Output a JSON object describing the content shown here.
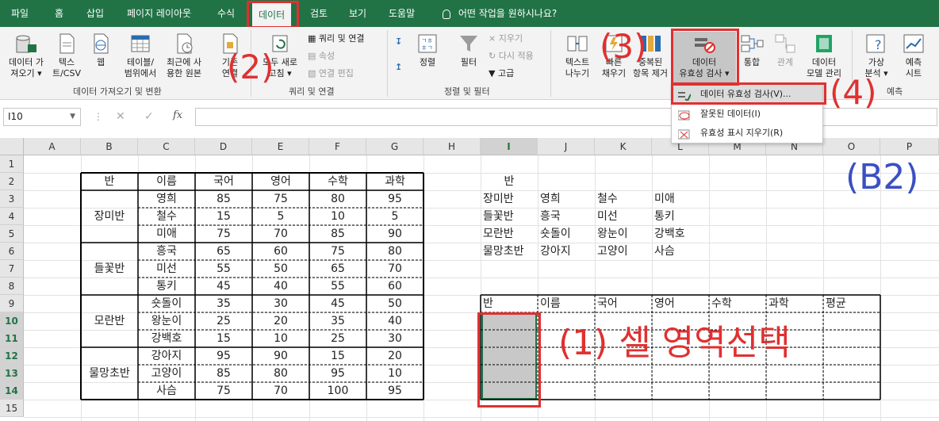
{
  "tabs": [
    "파일",
    "홈",
    "삽입",
    "페이지 레이아웃",
    "수식",
    "데이터",
    "검토",
    "보기",
    "도움말"
  ],
  "tell_me": "어떤 작업을 원하시나요?",
  "ribbon": {
    "get_data": {
      "line1": "데이터 가",
      "line2": "져오기"
    },
    "text_csv": {
      "line1": "텍스",
      "line2": "트/CSV"
    },
    "web": {
      "line1": "웹"
    },
    "from_table": {
      "line1": "테이블/",
      "line2": "범위에서"
    },
    "recent": {
      "line1": "최근에 사",
      "line2": "용한 원본"
    },
    "existing": {
      "line1": "기존",
      "line2": "연결"
    },
    "refresh": {
      "line1": "모두 새로",
      "line2": "고침"
    },
    "queries": "쿼리 및 연결",
    "properties": "속성",
    "edit_links": "연결 편집",
    "sort_az": "",
    "sort": "정렬",
    "filter": "필터",
    "clear": "지우기",
    "reapply": "다시 적용",
    "advanced": "고급",
    "text_to_cols": {
      "line1": "텍스트",
      "line2": "나누기"
    },
    "flash_fill": {
      "line1": "빠른",
      "line2": "채우기"
    },
    "remove_dup": {
      "line1": "중복된",
      "line2": "항목 제거"
    },
    "validation": {
      "line1": "데이터",
      "line2": "유효성 검사"
    },
    "consolidate": {
      "line1": "통합"
    },
    "relations": {
      "line1": "관계"
    },
    "data_model": {
      "line1": "데이터",
      "line2": "모델 관리"
    },
    "what_if": {
      "line1": "가상",
      "line2": "분석"
    },
    "forecast": {
      "line1": "예측",
      "line2": "시트"
    },
    "groups": {
      "get": "데이터 가져오기 및 변환",
      "query": "쿼리 및 연결",
      "sort": "정렬 및 필터",
      "forecast": "예측"
    }
  },
  "dropdown": [
    "데이터 유효성 검사(V)...",
    "잘못된 데이터(I)",
    "유효성 표시 지우기(R)"
  ],
  "name_box": "I10",
  "formula": "",
  "columns": [
    "A",
    "B",
    "C",
    "D",
    "E",
    "F",
    "G",
    "H",
    "I",
    "J",
    "K",
    "L",
    "M",
    "N",
    "O",
    "P"
  ],
  "rows": [
    "1",
    "2",
    "3",
    "4",
    "5",
    "6",
    "7",
    "8",
    "9",
    "10",
    "11",
    "12",
    "13",
    "14",
    "15"
  ],
  "table1": {
    "headers": [
      "반",
      "이름",
      "국어",
      "영어",
      "수학",
      "과학"
    ],
    "classes": [
      "장미반",
      "들꽃반",
      "모란반",
      "물망초반"
    ],
    "rows": [
      [
        "영희",
        "85",
        "75",
        "80",
        "95"
      ],
      [
        "철수",
        "15",
        "5",
        "10",
        "5"
      ],
      [
        "미애",
        "75",
        "70",
        "85",
        "90"
      ],
      [
        "흥국",
        "65",
        "60",
        "75",
        "80"
      ],
      [
        "미선",
        "55",
        "50",
        "65",
        "70"
      ],
      [
        "통키",
        "45",
        "40",
        "55",
        "60"
      ],
      [
        "숏돌이",
        "35",
        "30",
        "45",
        "50"
      ],
      [
        "왕눈이",
        "25",
        "20",
        "35",
        "40"
      ],
      [
        "강백호",
        "15",
        "10",
        "25",
        "30"
      ],
      [
        "강아지",
        "95",
        "90",
        "15",
        "20"
      ],
      [
        "고양이",
        "85",
        "80",
        "95",
        "10"
      ],
      [
        "사슴",
        "75",
        "70",
        "100",
        "95"
      ]
    ]
  },
  "list": {
    "header": "반",
    "rows": [
      [
        "장미반",
        "영희",
        "철수",
        "미애"
      ],
      [
        "들꽃반",
        "흥국",
        "미선",
        "통키"
      ],
      [
        "모란반",
        "숏돌이",
        "왕눈이",
        "강백호"
      ],
      [
        "물망초반",
        "강아지",
        "고양이",
        "사슴"
      ]
    ]
  },
  "table2": {
    "headers": [
      "반",
      "이름",
      "국어",
      "영어",
      "수학",
      "과학",
      "평균"
    ]
  },
  "annotations": {
    "a1": "(1) 셀 영역선택",
    "a2": "(2)",
    "a3": "(3)",
    "a4": "(4)",
    "b2": "(B2)"
  },
  "colors": {
    "excel_green": "#217346",
    "annotation_red": "#e03030",
    "annotation_blue": "#3b4fc4"
  }
}
